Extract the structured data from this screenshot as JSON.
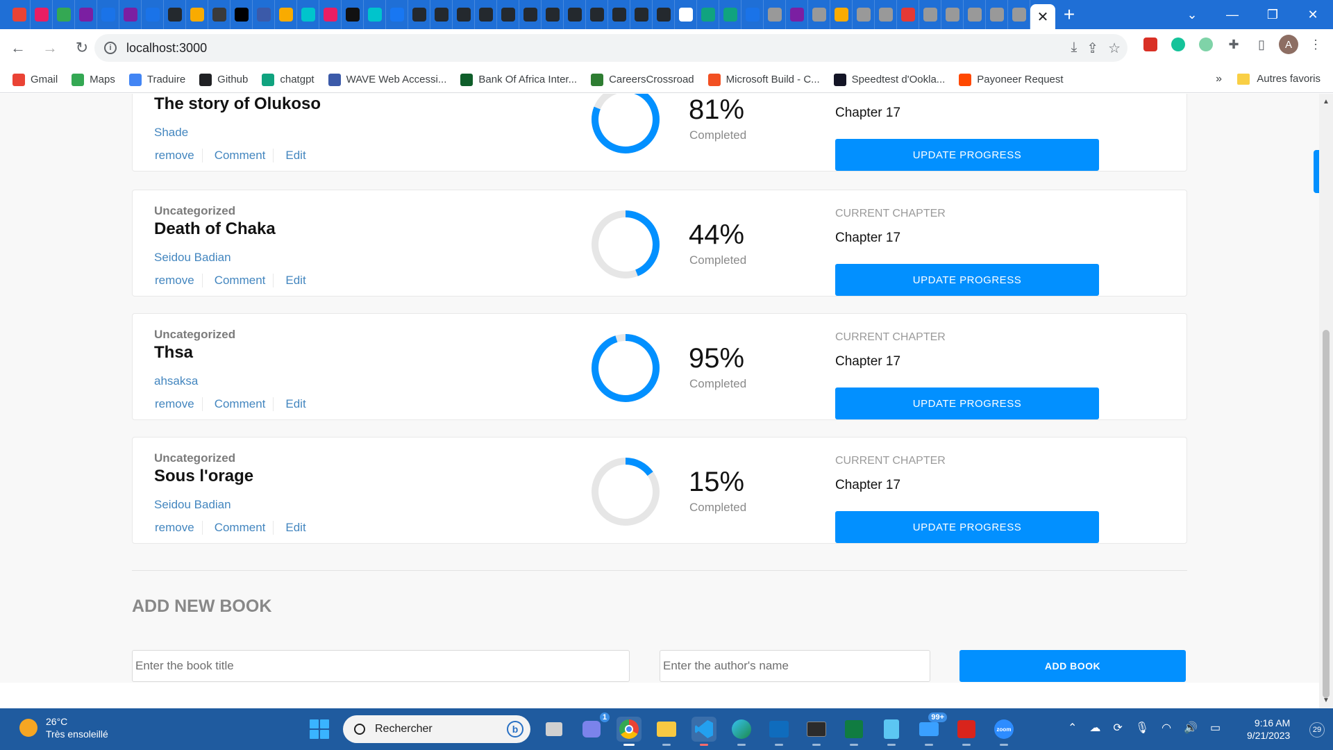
{
  "browser": {
    "url": "localhost:3000",
    "bookmarks": [
      {
        "label": "Gmail",
        "color": "#ea4335"
      },
      {
        "label": "Maps",
        "color": "#34a853"
      },
      {
        "label": "Traduire",
        "color": "#4285f4"
      },
      {
        "label": "Github",
        "color": "#202124"
      },
      {
        "label": "chatgpt",
        "color": "#10a37f"
      },
      {
        "label": "WAVE Web Accessi...",
        "color": "#3b5aa9"
      },
      {
        "label": "Bank Of Africa Inter...",
        "color": "#0f5e2a"
      },
      {
        "label": "CareersCrossroad",
        "color": "#2e7d32"
      },
      {
        "label": "Microsoft Build - C...",
        "color": "#f25022"
      },
      {
        "label": "Speedtest d'Ookla...",
        "color": "#141526"
      },
      {
        "label": "Payoneer Request",
        "color": "#ff4800"
      }
    ],
    "bookmarks_more": "»",
    "bookmarks_folder": "Autres favoris",
    "avatar_letter": "A"
  },
  "books": [
    {
      "genre": "",
      "title": "The story of Olukoso",
      "author": "Shade",
      "percent": 81,
      "percent_text": "81%",
      "completed_label": "Completed",
      "chapter_label": "",
      "chapter": "Chapter 17",
      "update_label": "UPDATE PROGRESS"
    },
    {
      "genre": "Uncategorized",
      "title": "Death of Chaka",
      "author": "Seidou Badian",
      "percent": 44,
      "percent_text": "44%",
      "completed_label": "Completed",
      "chapter_label": "CURRENT CHAPTER",
      "chapter": "Chapter 17",
      "update_label": "UPDATE PROGRESS"
    },
    {
      "genre": "Uncategorized",
      "title": "Thsa",
      "author": "ahsaksa",
      "percent": 95,
      "percent_text": "95%",
      "completed_label": "Completed",
      "chapter_label": "CURRENT CHAPTER",
      "chapter": "Chapter 17",
      "update_label": "UPDATE PROGRESS"
    },
    {
      "genre": "Uncategorized",
      "title": "Sous l'orage",
      "author": "Seidou Badian",
      "percent": 15,
      "percent_text": "15%",
      "completed_label": "Completed",
      "chapter_label": "CURRENT CHAPTER",
      "chapter": "Chapter 17",
      "update_label": "UPDATE PROGRESS"
    }
  ],
  "actions": {
    "remove": "remove",
    "comment": "Comment",
    "edit": "Edit"
  },
  "form": {
    "title": "ADD NEW BOOK",
    "title_placeholder": "Enter the book title",
    "author_placeholder": "Enter the author's name",
    "submit_label": "ADD BOOK"
  },
  "colors": {
    "accent": "#0290ff",
    "link": "#4386bf",
    "ring_track": "#e6e6e6"
  },
  "taskbar": {
    "weather_temp": "26°C",
    "weather_desc": "Très ensoleillé",
    "search_placeholder": "Rechercher",
    "teams_badge": "1",
    "mail_badge": "99+",
    "zoom_label": "zoom",
    "time": "9:16 AM",
    "date": "9/21/2023",
    "notifications": "29"
  }
}
